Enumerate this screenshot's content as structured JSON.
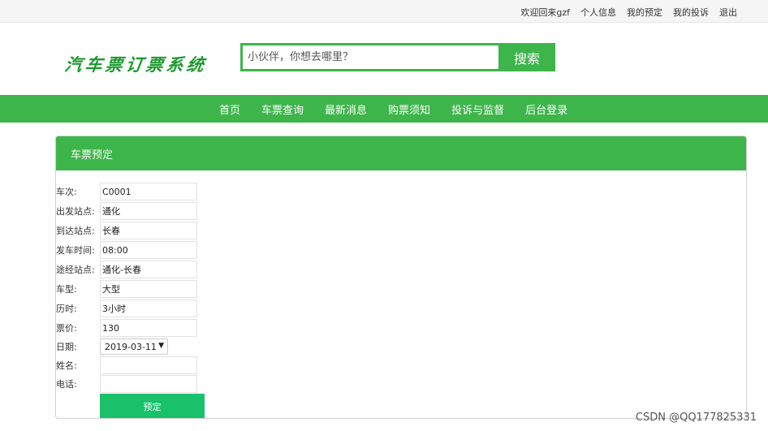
{
  "topbar": {
    "welcome": "欢迎回来gzf",
    "profile": "个人信息",
    "my_booking": "我的预定",
    "my_complaint": "我的投诉",
    "logout": "退出"
  },
  "logo": {
    "text": "汽车票订票系统"
  },
  "search": {
    "placeholder": "小伙伴，你想去哪里？",
    "button": "搜索"
  },
  "nav": [
    "首页",
    "车票查询",
    "最新消息",
    "购票须知",
    "投诉与监督",
    "后台登录"
  ],
  "panel": {
    "title": "车票预定",
    "fields": [
      {
        "label": "车次:",
        "value": "C0001"
      },
      {
        "label": "出发站点:",
        "value": "通化"
      },
      {
        "label": "到达站点:",
        "value": "长春"
      },
      {
        "label": "发车时间:",
        "value": "08:00"
      },
      {
        "label": "途经站点:",
        "value": "通化-长春"
      },
      {
        "label": "车型:",
        "value": "大型"
      },
      {
        "label": "历时:",
        "value": "3小时"
      },
      {
        "label": "票价:",
        "value": "130"
      }
    ],
    "date": {
      "label": "日期:",
      "value": "2019-03-11"
    },
    "name": {
      "label": "姓名:",
      "value": ""
    },
    "phone": {
      "label": "电话:",
      "value": ""
    },
    "submit": "预定"
  },
  "watermark": "CSDN @QQ177825331",
  "colors": {
    "accent": "#3db54a",
    "submit": "#19c26a",
    "logo": "#1e9a2e"
  }
}
